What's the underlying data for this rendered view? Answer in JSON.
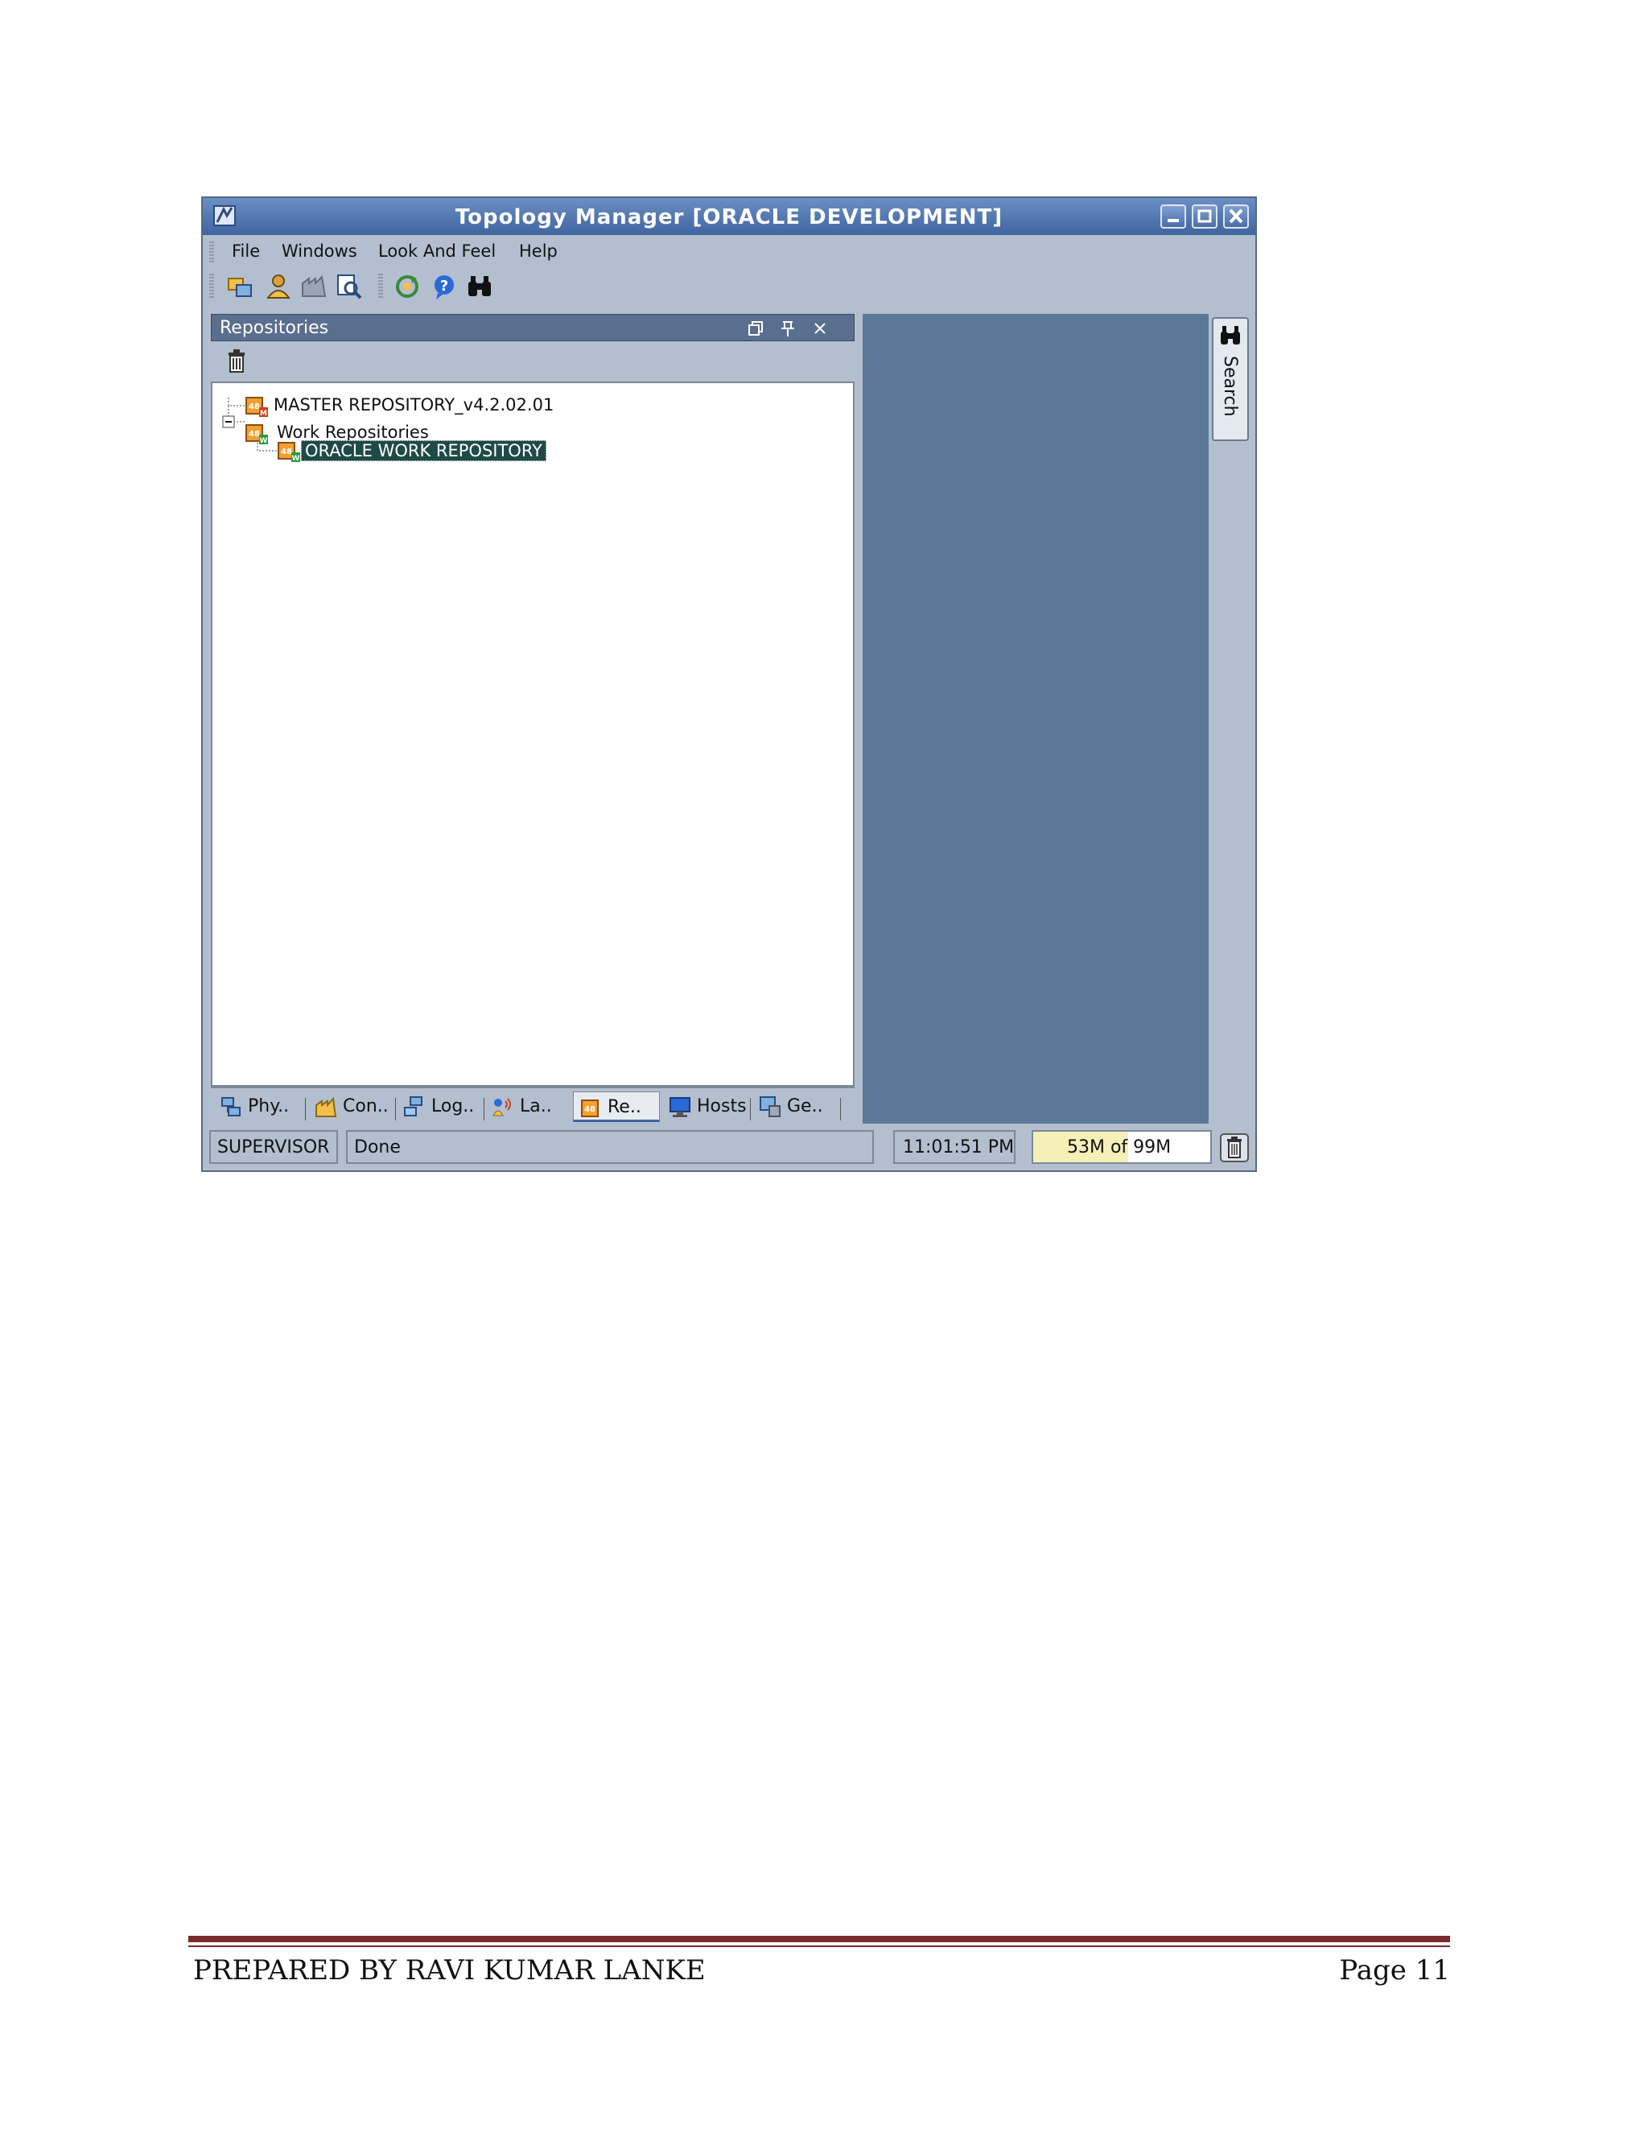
{
  "window": {
    "title": "Topology Manager [ORACLE DEVELOPMENT]"
  },
  "menu": {
    "file": "File",
    "windows": "Windows",
    "look_and_feel": "Look And Feel",
    "help": "Help"
  },
  "repositories_panel": {
    "title": "Repositories",
    "tree": {
      "master": "MASTER REPOSITORY_v4.2.02.01",
      "work_repositories": "Work Repositories",
      "selected_work_repo": "ORACLE WORK REPOSITORY"
    }
  },
  "bottom_tabs": [
    {
      "label": "Phy.."
    },
    {
      "label": "Con.."
    },
    {
      "label": "Log.."
    },
    {
      "label": "La.."
    },
    {
      "label": "Re.."
    },
    {
      "label": "Hosts"
    },
    {
      "label": "Ge.."
    }
  ],
  "search_sidebar": {
    "label": "Search"
  },
  "status": {
    "user": "SUPERVISOR",
    "message": "Done",
    "time": "11:01:51 PM",
    "memory_text": "53M of 99M",
    "memory_used_fraction": 0.535
  },
  "footer": {
    "author": "PREPARED BY RAVI KUMAR LANKE",
    "page": "Page 11"
  },
  "colors": {
    "title_bar": "#4a6ea8",
    "work_area": "#5c7899",
    "panel_header": "#5a6f8f",
    "selection": "#1f4a47",
    "footer_rule": "#7a2b2b"
  }
}
